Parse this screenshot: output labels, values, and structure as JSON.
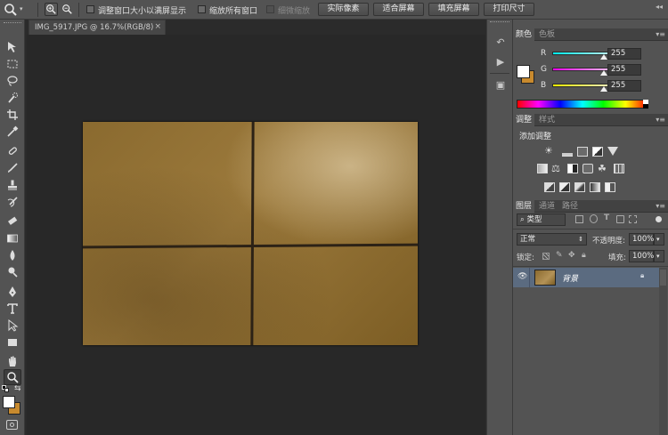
{
  "options_bar": {
    "checkbox_resize": "调整窗口大小以满屏显示",
    "checkbox_zoom_all": "缩放所有窗口",
    "checkbox_scrubby": "细微缩放",
    "btn_actual_pixels": "实际像素",
    "btn_fit_screen": "适合屏幕",
    "btn_fill_screen": "填充屏幕",
    "btn_print_size": "打印尺寸"
  },
  "document": {
    "tab_label": "IMG_5917.JPG @ 16.7%(RGB/8)",
    "close_glyph": "×"
  },
  "color_panel": {
    "tabs": [
      "颜色",
      "色板"
    ],
    "channels": [
      {
        "label": "R",
        "value": "255",
        "gradient": "linear-gradient(90deg,#00ffff,#ffffff)"
      },
      {
        "label": "G",
        "value": "255",
        "gradient": "linear-gradient(90deg,#ff00ff,#ffffff)"
      },
      {
        "label": "B",
        "value": "255",
        "gradient": "linear-gradient(90deg,#ffff00,#ffffff)"
      }
    ],
    "foreground": "#ffffff",
    "background": "#c88a2e"
  },
  "adjust_panel": {
    "tabs": [
      "调整",
      "样式"
    ],
    "heading": "添加调整"
  },
  "layers_panel": {
    "tabs": [
      "图层",
      "通道",
      "路径"
    ],
    "filter_kind": "类型",
    "blend_mode": "正常",
    "opacity_label": "不透明度:",
    "opacity_value": "100%",
    "lock_label": "锁定:",
    "fill_label": "填充:",
    "fill_value": "100%",
    "layers": [
      {
        "name": "背景",
        "visible": true,
        "locked": true
      }
    ]
  },
  "colors": {
    "ui_bg": "#535353",
    "workspace": "#282828",
    "selected_layer": "#5b6b80"
  }
}
